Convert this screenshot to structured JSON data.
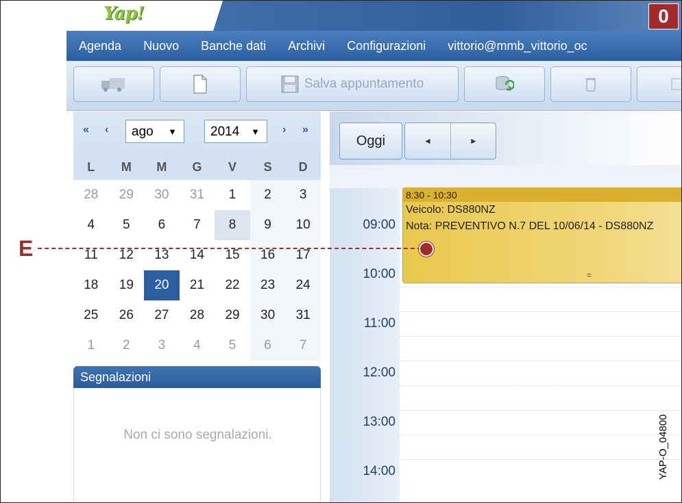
{
  "header": {
    "logo_text": "Yap!",
    "badge": "0"
  },
  "menu": [
    "Agenda",
    "Nuovo",
    "Banche dati",
    "Archivi",
    "Configurazioni",
    "vittorio@mmb_vittorio_oc"
  ],
  "toolbar": {
    "save_label": "Salva appuntamento"
  },
  "calendar": {
    "month": "ago",
    "year": "2014",
    "nav": {
      "first": "«",
      "prev": "‹",
      "next": "›",
      "last": "»"
    },
    "weekdays": [
      "L",
      "M",
      "M",
      "G",
      "V",
      "S",
      "D"
    ],
    "weeks": [
      [
        "28",
        "29",
        "30",
        "31",
        "1",
        "2",
        "3"
      ],
      [
        "4",
        "5",
        "6",
        "7",
        "8",
        "9",
        "10"
      ],
      [
        "11",
        "12",
        "13",
        "14",
        "15",
        "16",
        "17"
      ],
      [
        "18",
        "19",
        "20",
        "21",
        "22",
        "23",
        "24"
      ],
      [
        "25",
        "26",
        "27",
        "28",
        "29",
        "30",
        "31"
      ],
      [
        "1",
        "2",
        "3",
        "4",
        "5",
        "6",
        "7"
      ]
    ],
    "today": "20",
    "selected": "8"
  },
  "segnalazioni": {
    "title": "Segnalazioni",
    "empty": "Non ci sono segnalazioni."
  },
  "agenda": {
    "today_label": "Oggi",
    "prev_glyph": "◄",
    "next_glyph": "►",
    "hours": [
      "09:00",
      "10:00",
      "11:00",
      "12:00",
      "13:00",
      "14:00"
    ],
    "event": {
      "time": "8:30 - 10:30",
      "vehicle": "Veicolo: DS880NZ",
      "note": "Nota: PREVENTIVO N.7 DEL 10/06/14 - DS880NZ",
      "handle": "="
    }
  },
  "annotation": {
    "label": "E"
  },
  "reference_code": "YAP-O_04800",
  "colors": {
    "accent": "#2c5f9f",
    "callout": "#a32a2a",
    "event": "#e9c84e"
  }
}
